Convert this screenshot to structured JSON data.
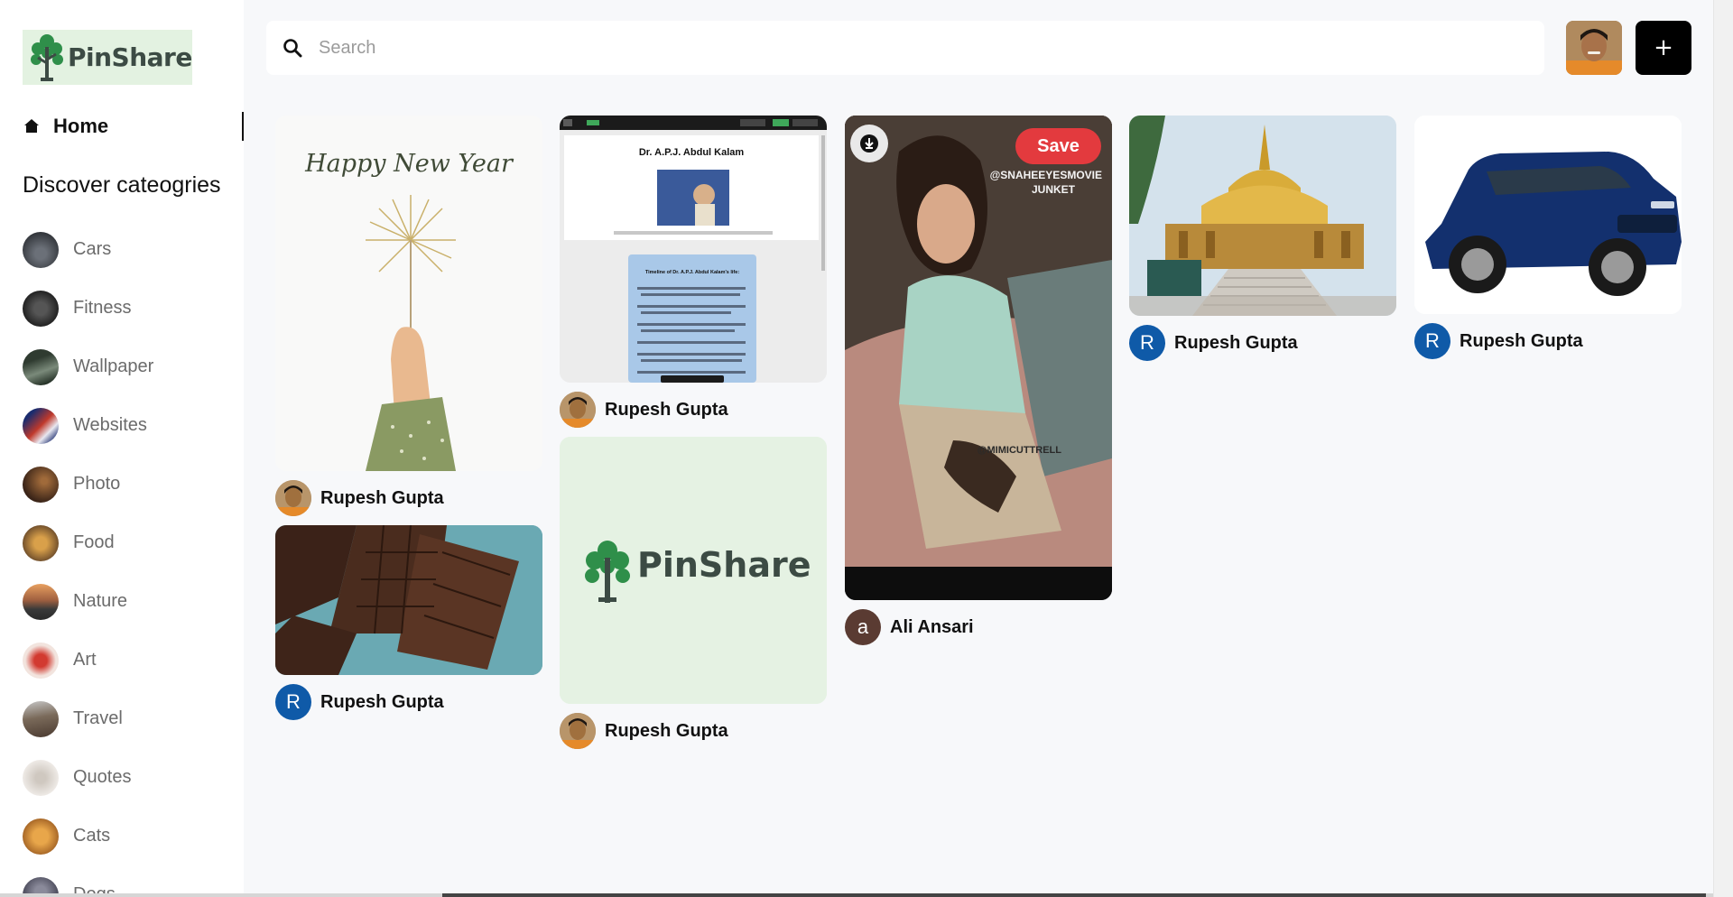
{
  "brand": {
    "name": "PinShare"
  },
  "nav": {
    "home_label": "Home"
  },
  "sidebar": {
    "discover_title": "Discover cateogries",
    "categories": [
      {
        "label": "Cars",
        "color": "#4a4f57"
      },
      {
        "label": "Fitness",
        "color": "#2d2d2d"
      },
      {
        "label": "Wallpaper",
        "color": "#3b4a3c"
      },
      {
        "label": "Websites",
        "color": "#2a3b7a"
      },
      {
        "label": "Photo",
        "color": "#4b3324"
      },
      {
        "label": "Food",
        "color": "#8a6a3a"
      },
      {
        "label": "Nature",
        "color": "#6a4a3a"
      },
      {
        "label": "Art",
        "color": "#c84a42"
      },
      {
        "label": "Travel",
        "color": "#6a5a4a"
      },
      {
        "label": "Quotes",
        "color": "#ddd8d0"
      },
      {
        "label": "Cats",
        "color": "#c98a3a"
      },
      {
        "label": "Dogs",
        "color": "#4a4a5a"
      }
    ]
  },
  "search": {
    "placeholder": "Search",
    "icon": "search-icon"
  },
  "header": {
    "add_label": "+"
  },
  "pins": [
    {
      "id": "new-year",
      "author": "Rupesh Gupta",
      "avatar": "photo",
      "image": "Happy New Year",
      "image_text": "Happy New Year"
    },
    {
      "id": "chocolate",
      "author": "Rupesh Gupta",
      "avatar": "R",
      "avatar_color": "#0f5aa8",
      "image": "chocolate bars"
    },
    {
      "id": "kalam",
      "author": "Rupesh Gupta",
      "avatar": "photo",
      "image": "website screenshot",
      "page_heading": "Dr. A.P.J. Abdul Kalam",
      "timeline_heading": "Timeline of Dr. A.P.J. Abdul Kalam's life:"
    },
    {
      "id": "pinshare-logo",
      "author": "Rupesh Gupta",
      "avatar": "photo",
      "image": "PinShare logo",
      "image_text": "PinShare"
    },
    {
      "id": "portrait",
      "author": "Ali Ansari",
      "avatar": "a",
      "avatar_color": "#5a3b32",
      "image": "portrait photo",
      "save_label": "Save",
      "image_text": [
        "@SNAHEEYESMOVIE",
        "JUNKET",
        "@MIMICUTTRELL"
      ]
    },
    {
      "id": "pagoda",
      "author": "Rupesh Gupta",
      "avatar": "R",
      "avatar_color": "#0f5aa8",
      "image": "golden pagoda"
    },
    {
      "id": "suv",
      "author": "Rupesh Gupta",
      "avatar": "R",
      "avatar_color": "#0f5aa8",
      "image": "blue SUV"
    }
  ]
}
